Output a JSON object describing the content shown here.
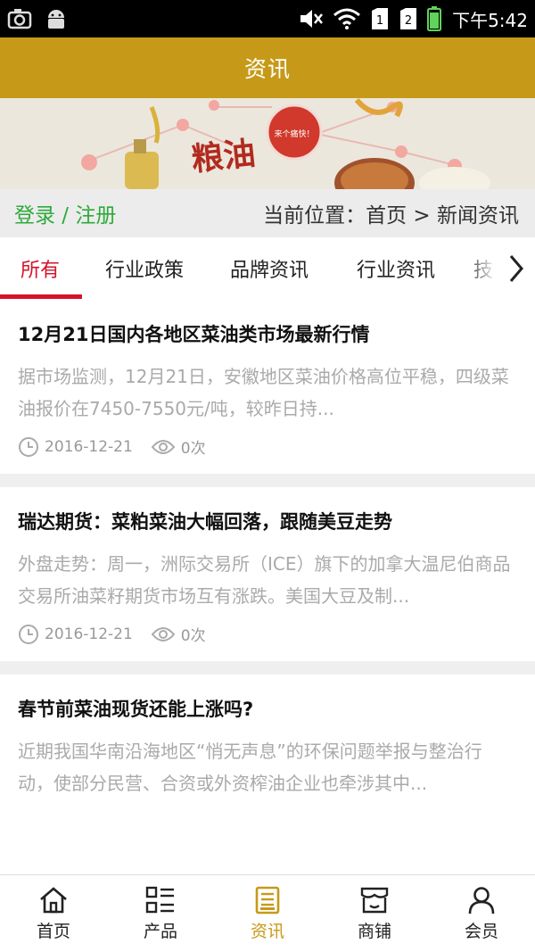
{
  "status_bar": {
    "time": "下午5:42",
    "icons": [
      "camera-icon",
      "android-icon",
      "mute-icon",
      "wifi-icon",
      "sim1-icon",
      "sim2-icon",
      "battery-icon"
    ]
  },
  "header": {
    "title": "资讯"
  },
  "banner": {
    "text": "粮油",
    "badge_text": "来个痛快！"
  },
  "location_bar": {
    "login_label": "登录 / 注册",
    "location_text": "当前位置：首页 > 新闻资讯"
  },
  "tabs": [
    {
      "label": "所有",
      "active": true
    },
    {
      "label": "行业政策",
      "active": false
    },
    {
      "label": "品牌资讯",
      "active": false
    },
    {
      "label": "行业资讯",
      "active": false
    },
    {
      "label": "技",
      "active": false
    }
  ],
  "articles": [
    {
      "title": "12月21日国内各地区菜油类市场最新行情",
      "summary": "据市场监测，12月21日，安徽地区菜油价格高位平稳，四级菜油报价在7450-7550元/吨，较昨日持...",
      "date": "2016-12-21",
      "views": "0次"
    },
    {
      "title": "瑞达期货：菜粕菜油大幅回落，跟随美豆走势",
      "summary": "外盘走势：周一，洲际交易所（ICE）旗下的加拿大温尼伯商品交易所油菜籽期货市场互有涨跌。美国大豆及制...",
      "date": "2016-12-21",
      "views": "0次"
    },
    {
      "title": "春节前菜油现货还能上涨吗?",
      "summary": "近期我国华南沿海地区“悄无声息”的环保问题举报与整治行动，使部分民营、合资或外资榨油企业也牵涉其中...",
      "date": "",
      "views": ""
    }
  ],
  "bottom_nav": [
    {
      "label": "首页",
      "icon": "home-icon",
      "active": false
    },
    {
      "label": "产品",
      "icon": "list-icon",
      "active": false
    },
    {
      "label": "资讯",
      "icon": "news-icon",
      "active": true
    },
    {
      "label": "商铺",
      "icon": "store-icon",
      "active": false
    },
    {
      "label": "会员",
      "icon": "user-icon",
      "active": false
    }
  ],
  "colors": {
    "header_bg": "#c69a18",
    "active_tab": "#d4142a",
    "login_link": "#2eaa3a",
    "nav_active": "#c69a18"
  }
}
